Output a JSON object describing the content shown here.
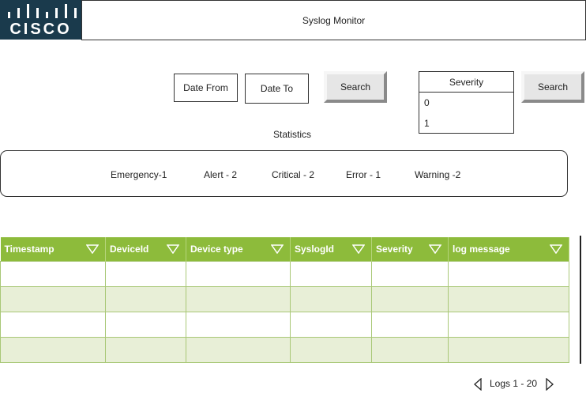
{
  "logo": {
    "text": "CISCO",
    "bg_color": "#1a3a4c",
    "icon": "cisco-bridge-icon"
  },
  "header": {
    "title": "Syslog Monitor"
  },
  "filters": {
    "date_from": "Date From",
    "date_to": "Date To",
    "search_label": "Search"
  },
  "severity": {
    "title": "Severity",
    "options": [
      "0",
      "1"
    ],
    "search_label": "Search"
  },
  "statistics": {
    "label": "Statistics",
    "items": [
      "Emergency-1",
      "Alert - 2",
      "Critical - 2",
      "Error - 1",
      "Warning -2"
    ]
  },
  "table": {
    "header_color": "#8dbb3b",
    "alt_row_color": "#e8efd7",
    "columns": [
      "Timestamp",
      "DeviceId",
      "Device type",
      "SyslogId",
      "Severity",
      "log message"
    ],
    "rows": [
      [
        "",
        "",
        "",
        "",
        "",
        ""
      ],
      [
        "",
        "",
        "",
        "",
        "",
        ""
      ],
      [
        "",
        "",
        "",
        "",
        "",
        ""
      ],
      [
        "",
        "",
        "",
        "",
        "",
        ""
      ]
    ]
  },
  "pager": {
    "label": "Logs 1 - 20",
    "prev_icon": "triangle-left-icon",
    "next_icon": "triangle-right-icon"
  }
}
